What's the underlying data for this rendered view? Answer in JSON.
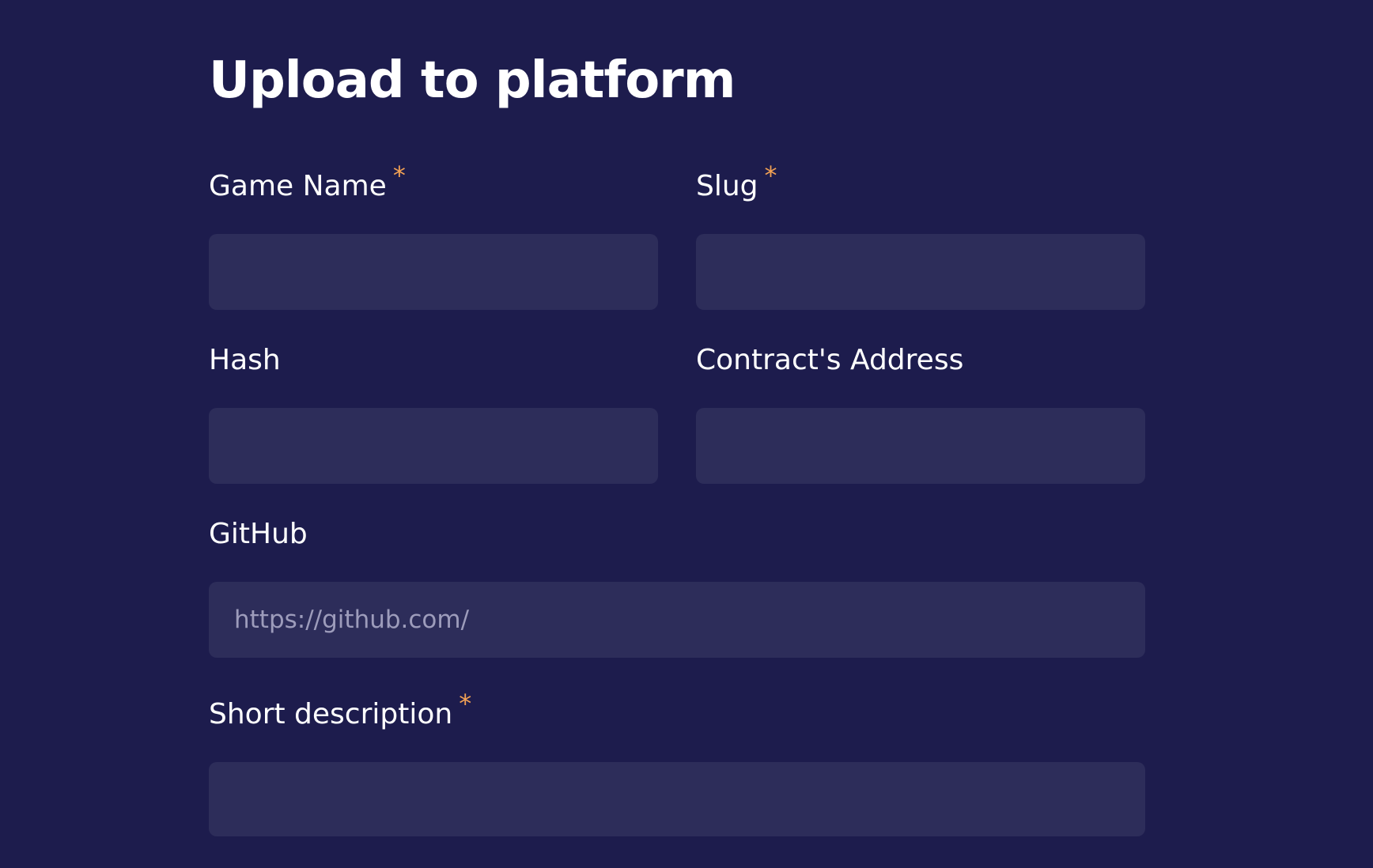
{
  "page": {
    "title": "Upload to platform"
  },
  "form": {
    "required_marker": "*",
    "fields": {
      "game_name": {
        "label": "Game Name",
        "value": "",
        "placeholder": "",
        "required": true
      },
      "slug": {
        "label": "Slug",
        "value": "",
        "placeholder": "",
        "required": true
      },
      "hash": {
        "label": "Hash",
        "value": "",
        "placeholder": "",
        "required": false
      },
      "contract_address": {
        "label": "Contract's Address",
        "value": "",
        "placeholder": "",
        "required": false
      },
      "github": {
        "label": "GitHub",
        "value": "",
        "placeholder": "https://github.com/",
        "required": false
      },
      "short_description": {
        "label": "Short description",
        "value": "",
        "placeholder": "",
        "required": true
      }
    }
  },
  "colors": {
    "background": "#1d1c4d",
    "input_background": "#2d2d5a",
    "required_star": "#f2a154",
    "placeholder_text": "#9d9cbb",
    "text": "#ffffff"
  }
}
